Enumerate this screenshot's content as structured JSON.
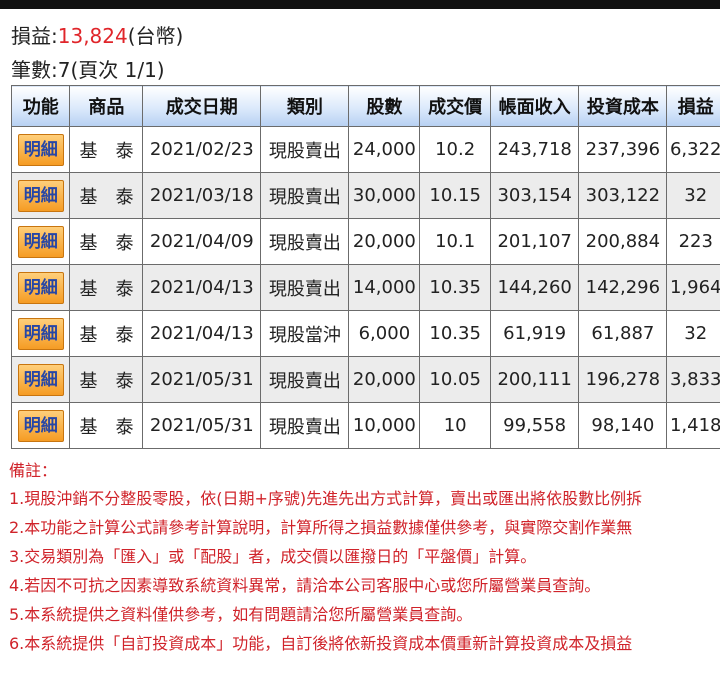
{
  "summary": {
    "pl_label": "損益:",
    "pl_value": "13,824",
    "pl_unit": "(台幣)",
    "count_text": "筆數:7(頁次 1/1)"
  },
  "table": {
    "headers": [
      "功能",
      "商品",
      "成交日期",
      "類別",
      "股數",
      "成交價",
      "帳面收入",
      "投資成本",
      "損益"
    ],
    "rows": [
      {
        "action": "明細",
        "product": [
          "基",
          "泰"
        ],
        "date": "2021/02/23",
        "type": "現股賣出",
        "shares": "24,000",
        "price": "10.2",
        "income": "243,718",
        "cost": "237,396",
        "pl": "6,322"
      },
      {
        "action": "明細",
        "product": [
          "基",
          "泰"
        ],
        "date": "2021/03/18",
        "type": "現股賣出",
        "shares": "30,000",
        "price": "10.15",
        "income": "303,154",
        "cost": "303,122",
        "pl": "32"
      },
      {
        "action": "明細",
        "product": [
          "基",
          "泰"
        ],
        "date": "2021/04/09",
        "type": "現股賣出",
        "shares": "20,000",
        "price": "10.1",
        "income": "201,107",
        "cost": "200,884",
        "pl": "223"
      },
      {
        "action": "明細",
        "product": [
          "基",
          "泰"
        ],
        "date": "2021/04/13",
        "type": "現股賣出",
        "shares": "14,000",
        "price": "10.35",
        "income": "144,260",
        "cost": "142,296",
        "pl": "1,964"
      },
      {
        "action": "明細",
        "product": [
          "基",
          "泰"
        ],
        "date": "2021/04/13",
        "type": "現股當沖",
        "shares": "6,000",
        "price": "10.35",
        "income": "61,919",
        "cost": "61,887",
        "pl": "32"
      },
      {
        "action": "明細",
        "product": [
          "基",
          "泰"
        ],
        "date": "2021/05/31",
        "type": "現股賣出",
        "shares": "20,000",
        "price": "10.05",
        "income": "200,111",
        "cost": "196,278",
        "pl": "3,833"
      },
      {
        "action": "明細",
        "product": [
          "基",
          "泰"
        ],
        "date": "2021/05/31",
        "type": "現股賣出",
        "shares": "10,000",
        "price": "10",
        "income": "99,558",
        "cost": "98,140",
        "pl": "1,418"
      }
    ]
  },
  "notes": {
    "title": "備註：",
    "lines": [
      "1.現股沖銷不分整股零股，依(日期+序號)先進先出方式計算，賣出或匯出將依股數比例拆",
      "2.本功能之計算公式請參考計算說明，計算所得之損益數據僅供參考，與實際交割作業無",
      "3.交易類別為「匯入」或「配股」者，成交價以匯撥日的「平盤價」計算。",
      "4.若因不可抗之因素導致系統資料異常，請洽本公司客服中心或您所屬營業員查詢。",
      "5.本系統提供之資料僅供參考，如有問題請洽您所屬營業員查詢。",
      "6.本系統提供「自訂投資成本」功能，自訂後將依新投資成本價重新計算投資成本及損益"
    ]
  },
  "colors": {
    "profit_red": "#e0252a",
    "product_blue": "#2b4fa8",
    "detail_button_orange": "#f59c24",
    "header_blue": "#b7d0f2"
  }
}
